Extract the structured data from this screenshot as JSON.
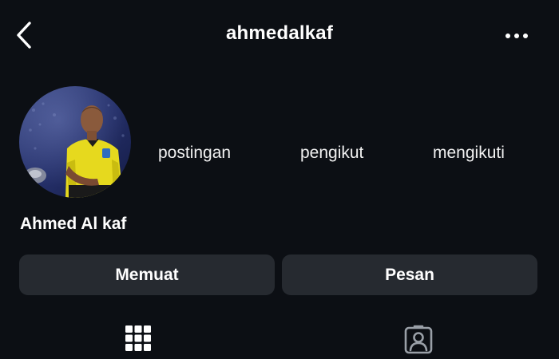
{
  "header": {
    "username": "ahmedalkaf",
    "back_icon": "chevron-left-icon",
    "more_icon": "more-horizontal-icon"
  },
  "profile": {
    "display_name": "Ahmed Al kaf",
    "avatar_alt": "profile photo"
  },
  "stats": {
    "posts_label": "postingan",
    "followers_label": "pengikut",
    "following_label": "mengikuti"
  },
  "actions": {
    "follow_label": "Memuat",
    "message_label": "Pesan"
  },
  "tabs": [
    {
      "icon": "grid-icon"
    },
    {
      "icon": "tagged-person-icon"
    }
  ],
  "colors": {
    "background": "#0c0f14",
    "button_bg": "#262a30",
    "text": "#ffffff"
  }
}
